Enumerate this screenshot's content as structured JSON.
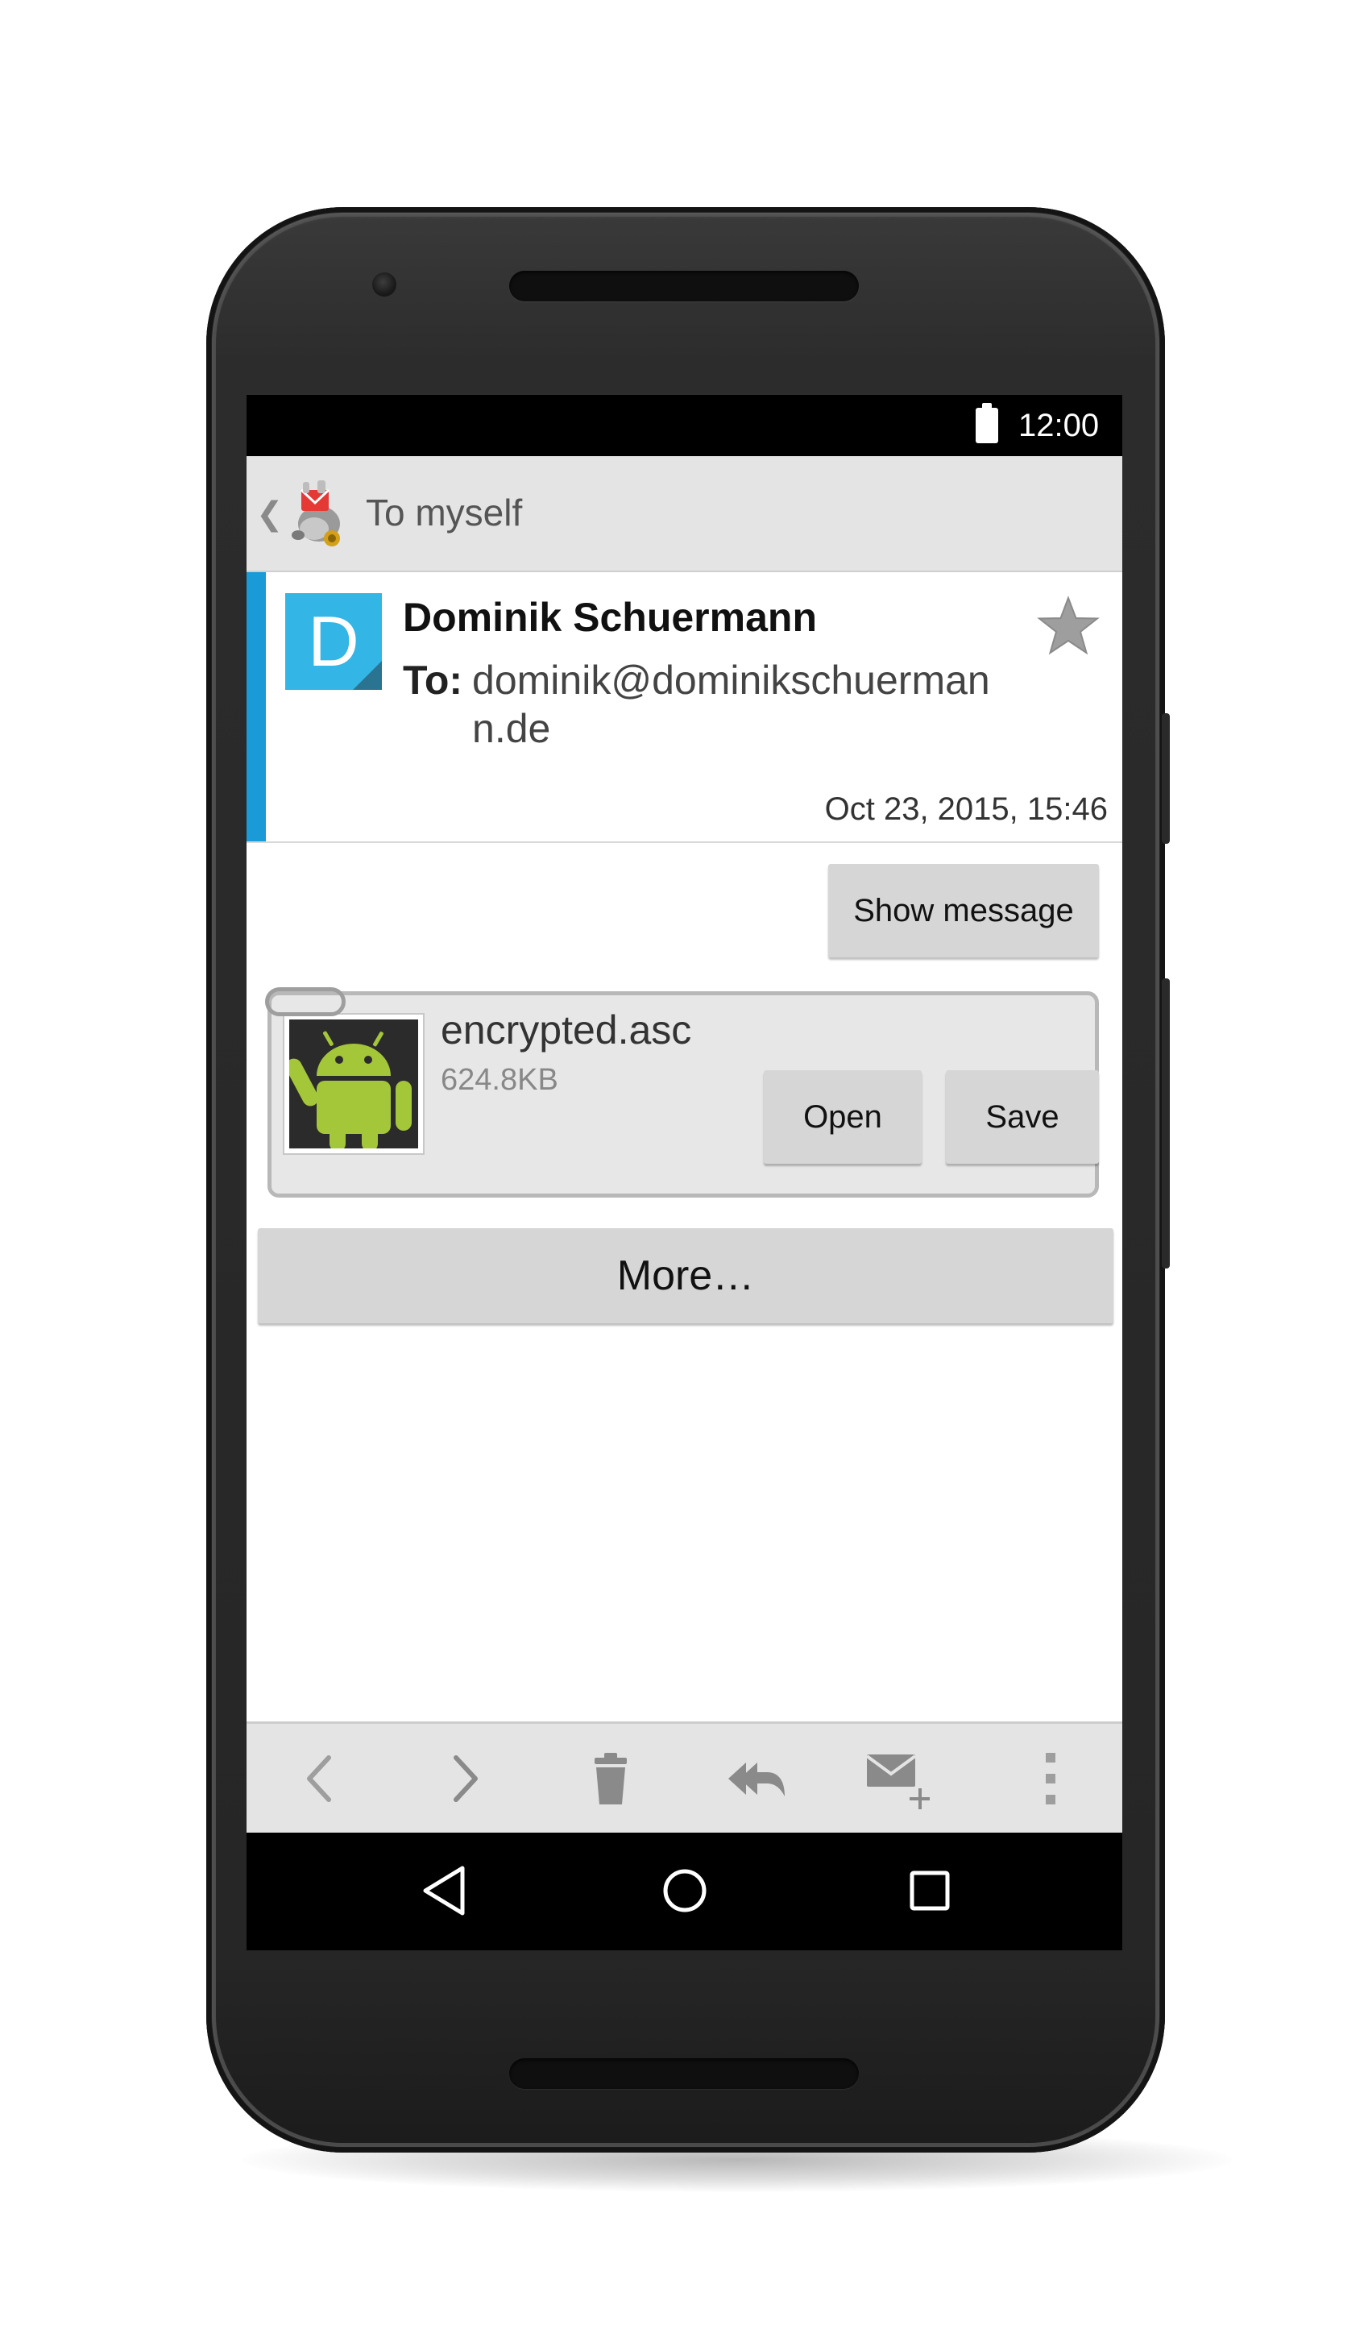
{
  "status_bar": {
    "time": "12:00"
  },
  "app_bar": {
    "title": "To myself"
  },
  "message": {
    "avatar_letter": "D",
    "sender": "Dominik Schuermann",
    "to_label": "To:",
    "to_value": "dominik@dominikschuermann.de",
    "date": "Oct 23, 2015, 15:46"
  },
  "buttons": {
    "show_message": "Show message",
    "open": "Open",
    "save": "Save",
    "more": "More…"
  },
  "attachment": {
    "filename": "encrypted.asc",
    "size": "624.8KB"
  },
  "icons": {
    "back": "chevron-left-icon",
    "app_logo": "k9-mail-dog-icon",
    "star": "star-icon",
    "toolbar": [
      "previous-icon",
      "next-icon",
      "delete-icon",
      "reply-all-icon",
      "compose-icon",
      "overflow-menu-icon"
    ],
    "navigation": [
      "nav-back-icon",
      "nav-home-icon",
      "nav-recents-icon"
    ]
  },
  "colors": {
    "accent": "#1a9ad6",
    "avatar": "#33b5e5",
    "android_green": "#a4c639"
  }
}
